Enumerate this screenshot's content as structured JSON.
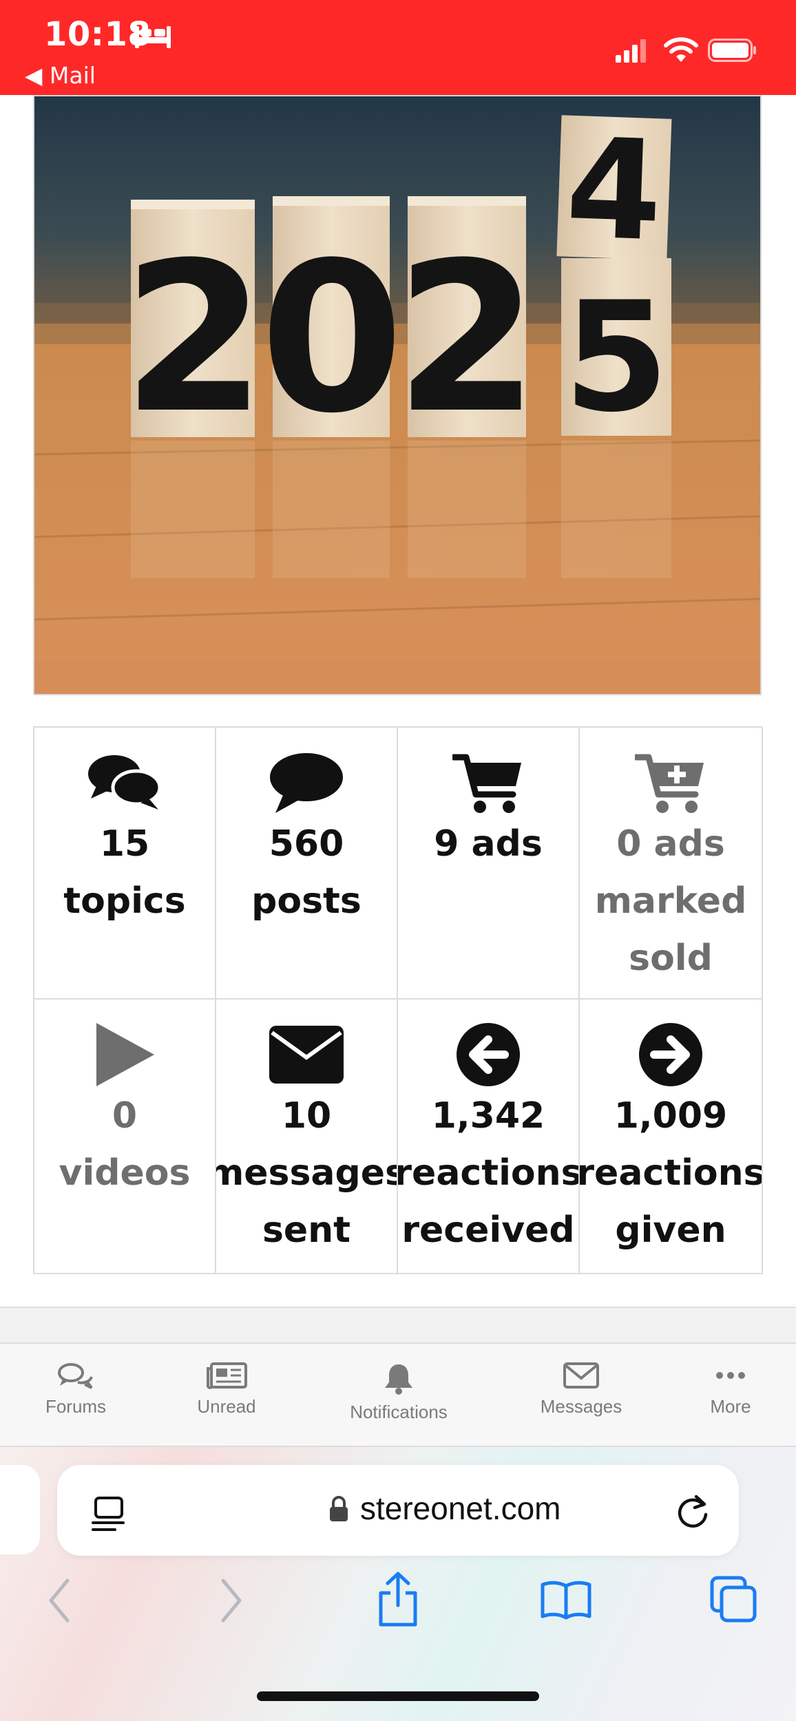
{
  "status_bar": {
    "time": "10:18",
    "back_label": "◀ Mail",
    "background": "#ff2828",
    "icons": [
      "bed-icon",
      "cellular-signal-icon",
      "wifi-icon",
      "battery-icon"
    ]
  },
  "hero_image": {
    "description_icon": "new-year-blocks-image",
    "blocks": [
      "2",
      "0",
      "2",
      "4",
      "5"
    ]
  },
  "stats": [
    {
      "icon": "topics-icon",
      "value": "15",
      "label": "topics",
      "dim": false
    },
    {
      "icon": "posts-icon",
      "value": "560",
      "label": "posts",
      "dim": false
    },
    {
      "icon": "cart-icon",
      "value": "9 ads",
      "label": "",
      "dim": false
    },
    {
      "icon": "cart-plus-icon",
      "value": "0 ads",
      "label": "marked",
      "label2": "sold",
      "dim": true
    },
    {
      "icon": "play-icon",
      "value": "0",
      "label": "videos",
      "dim": true
    },
    {
      "icon": "envelope-icon",
      "value": "10",
      "label": "messages",
      "label2": "sent",
      "dim": false
    },
    {
      "icon": "arrow-left-circle-icon",
      "value": "1,342",
      "label": "reactions",
      "label2": "received",
      "dim": false
    },
    {
      "icon": "arrow-right-circle-icon",
      "value": "1,009",
      "label": "reactions",
      "label2": "given",
      "dim": false
    }
  ],
  "tab_bar": {
    "items": [
      {
        "icon": "forums-icon",
        "label": "Forums"
      },
      {
        "icon": "unread-icon",
        "label": "Unread"
      },
      {
        "icon": "bell-icon",
        "label": "Notifications"
      },
      {
        "icon": "envelope-outline-icon",
        "label": "Messages"
      },
      {
        "icon": "more-icon",
        "label": "More"
      }
    ]
  },
  "browser": {
    "url": "stereonet.com",
    "accent": "#1a7cf4"
  }
}
